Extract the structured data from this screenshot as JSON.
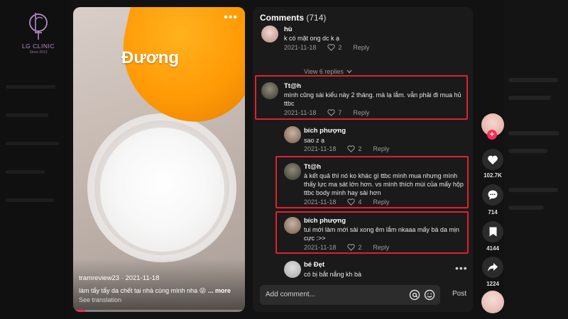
{
  "brand": {
    "name": "LG CLINIC",
    "since": "Since 2013"
  },
  "video": {
    "overlay_text": "Đương",
    "author_line": "tramreview23 · 2021-11-18",
    "caption": "làm tẩy tẩy da chết tại nhà cùng mình nha 😜",
    "more_label": "... more",
    "see_translation": "See translation",
    "progress": 0.07
  },
  "comments": {
    "title": "Comments",
    "count": "(714)",
    "view_replies": "View 6 replies",
    "items": [
      {
        "name": "hù",
        "text": "k có mặt ong dc k ạ",
        "date": "2021-11-18",
        "likes": "2",
        "reply": "Reply"
      },
      {
        "name": "Tt@h",
        "text": "mình cũng sài kiểu này 2 tháng. mà lạ lắm. vẫn phải đi mua hủ ttbc",
        "date": "2021-11-18",
        "likes": "7",
        "reply": "Reply"
      },
      {
        "name": "bích phượng",
        "text": "sao z ạ",
        "date": "2021-11-18",
        "likes": "2",
        "reply": "Reply"
      },
      {
        "name": "Tt@h",
        "text": "à kết quả thì nó ko khác gì ttbc mình mua nhưng mình thấy lực ma sát lớn hơn. vs mình thích mùi của mấy hộp ttbc body mình hay sài hơn",
        "date": "2021-11-18",
        "likes": "4",
        "reply": "Reply"
      },
      {
        "name": "bích phượng",
        "text": "tui mới làm mới sài xong êm lắm nkaaa mấy bà da mịn cực :>>",
        "date": "2021-11-18",
        "likes": "2",
        "reply": "Reply"
      },
      {
        "name": "bé Đẹt",
        "text": "có bị bắt nắng kh bà",
        "date": "",
        "likes": "",
        "reply": ""
      }
    ],
    "add_comment_placeholder": "Add comment...",
    "post_label": "Post"
  },
  "rail": {
    "likes": "102.7K",
    "comments": "714",
    "saves": "4144",
    "shares": "1224"
  },
  "colors": {
    "accent": "#fe2c55",
    "highlight": "#e0202f",
    "panel": "#1a1a1a"
  },
  "icons": [
    "heart-icon",
    "comment-icon",
    "bookmark-icon",
    "share-icon",
    "at-icon",
    "emoji-icon",
    "chevron-down-icon",
    "more-icon",
    "plus-icon"
  ]
}
